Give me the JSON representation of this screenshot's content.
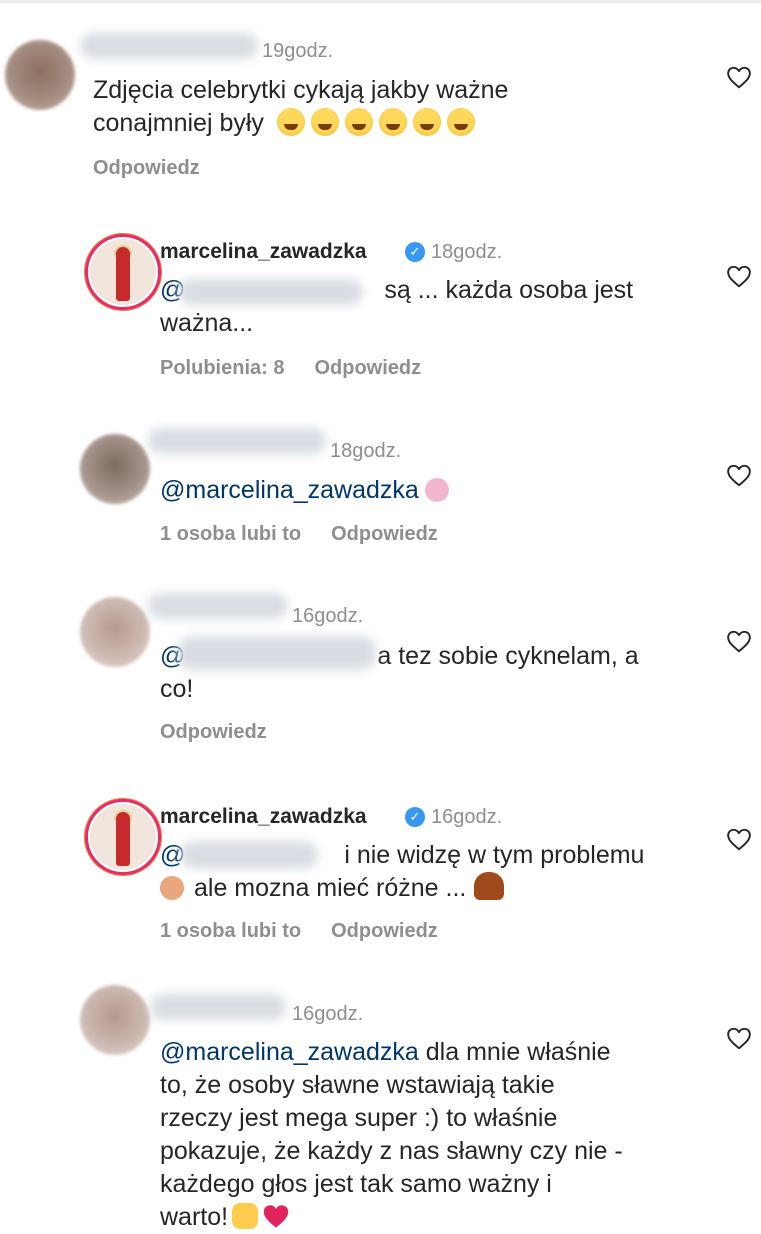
{
  "comments": [
    {
      "time": "19godz.",
      "lines": [
        "Zdjęcia celebrytki cykają jakby ważne",
        "conajmniej były"
      ],
      "reply_label": "Odpowiedz"
    },
    {
      "username": "marcelina_zawadzka",
      "time": "18godz.",
      "mention": "@",
      "lines": [
        "są ... każda osoba jest",
        "ważna..."
      ],
      "likes_label": "Polubienia: 8",
      "reply_label": "Odpowiedz"
    },
    {
      "time": "18godz.",
      "mention": "@marcelina_zawadzka",
      "likes_label": "1 osoba lubi to",
      "reply_label": "Odpowiedz"
    },
    {
      "time": "16godz.",
      "mention": "@",
      "lines": [
        "a tez sobie cyknelam, a",
        "co!"
      ],
      "reply_label": "Odpowiedz"
    },
    {
      "username": "marcelina_zawadzka",
      "time": "16godz.",
      "mention": "@",
      "lines": [
        "i nie widzę w tym problemu",
        "ale mozna mieć różne ..."
      ],
      "likes_label": "1 osoba lubi to",
      "reply_label": "Odpowiedz"
    },
    {
      "time": "16godz.",
      "mention": "@marcelina_zawadzka",
      "lines": [
        " dla mnie właśnie",
        "to, że osoby sławne wstawiają takie",
        "rzeczy jest mega super :) to właśnie",
        "pokazuje, że każdy z nas sławny czy nie -",
        "każdego głos jest tak samo ważny i",
        "warto!"
      ]
    }
  ],
  "icons": {
    "like": "heart-outline-icon",
    "verified": "verified-badge-icon"
  },
  "colors": {
    "mention": "#00376b",
    "secondary": "#8e8e8e",
    "verified": "#3897f0"
  }
}
